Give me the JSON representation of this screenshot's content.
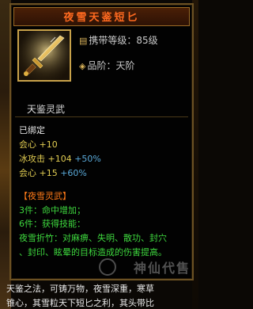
{
  "tooltip": {
    "title": "夜雪天鉴短匕",
    "level_label": "携带等级：85级",
    "rank_label": "品阶：天阶",
    "skill_name": "天鉴灵武",
    "bound_status": "已绑定",
    "base_stats": [
      {
        "name": "会心",
        "value": "+10",
        "bonus": ""
      },
      {
        "name": "冰攻击",
        "value": "+104",
        "bonus": "+50%"
      },
      {
        "name": "会心",
        "value": "+15",
        "bonus": "+60%"
      }
    ],
    "set": {
      "name": "【夜雪灵武】",
      "piece3": "3件：命中增加；",
      "piece6": "6件：获得技能：",
      "skill_line1": "夜雪折竹：对麻痹、失明、散功、封穴",
      "skill_line2": "、封印、眩晕的目标造成的伤害提高。"
    }
  },
  "background": {
    "line1": "天鉴之法，可铸万物，夜雪深重，寒草",
    "line2": "锥心，其雪粒天下短匕之利，其头带比"
  },
  "watermark": "神仙代售",
  "colors": {
    "title": "#ff6a20",
    "frame_border": "#6b5123",
    "stat_gold": "#e2cd52",
    "stat_blue": "#5aa9d8",
    "set_orange": "#ff7a18",
    "set_green": "#3ed83e"
  },
  "icons": {
    "item": "dagger-icon",
    "level": "scroll-icon",
    "rank": "diamond-icon"
  }
}
